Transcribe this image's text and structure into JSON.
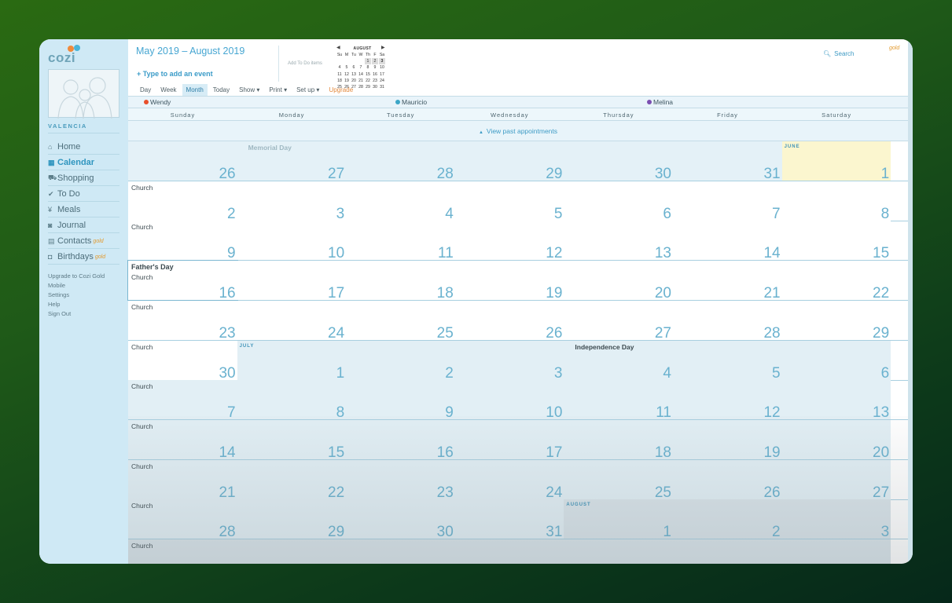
{
  "app": {
    "logo": "cozi"
  },
  "sidebar": {
    "family": "VALENCIA",
    "items": [
      {
        "icon": "home-icon",
        "glyph": "⌂",
        "label": "Home",
        "active": false,
        "gold": ""
      },
      {
        "icon": "calendar-icon",
        "glyph": "▦",
        "label": "Calendar",
        "active": true,
        "gold": ""
      },
      {
        "icon": "shopping-cart-icon",
        "glyph": "⛟",
        "label": "Shopping",
        "active": false,
        "gold": ""
      },
      {
        "icon": "checkmark-icon",
        "glyph": "✔",
        "label": "To Do",
        "active": false,
        "gold": ""
      },
      {
        "icon": "fork-knife-icon",
        "glyph": "¥",
        "label": "Meals",
        "active": false,
        "gold": ""
      },
      {
        "icon": "camera-icon",
        "glyph": "◙",
        "label": "Journal",
        "active": false,
        "gold": ""
      },
      {
        "icon": "contacts-icon",
        "glyph": "▤",
        "label": "Contacts",
        "active": false,
        "gold": "gold"
      },
      {
        "icon": "gift-icon",
        "glyph": "◘",
        "label": "Birthdays",
        "active": false,
        "gold": "gold"
      }
    ],
    "links": [
      "Upgrade to Cozi Gold",
      "Mobile",
      "Settings",
      "Help",
      "Sign Out"
    ]
  },
  "header": {
    "title": "May 2019 – August 2019",
    "add_event": "+ Type to add an event",
    "add_todo": "Add To Do items",
    "tabs": [
      {
        "label": "Day",
        "active": false,
        "kind": ""
      },
      {
        "label": "Week",
        "active": false,
        "kind": ""
      },
      {
        "label": "Month",
        "active": true,
        "kind": ""
      },
      {
        "label": "Today",
        "active": false,
        "kind": ""
      },
      {
        "label": "Show ▾",
        "active": false,
        "kind": ""
      },
      {
        "label": "Print ▾",
        "active": false,
        "kind": ""
      },
      {
        "label": "Set up ▾",
        "active": false,
        "kind": ""
      },
      {
        "label": "Upgrade",
        "active": false,
        "kind": "upgrade"
      }
    ],
    "search_placeholder": "Search",
    "gold_label": "gold"
  },
  "mini_calendar": {
    "title": "AUGUST",
    "prev": "◀",
    "next": "▶",
    "weekdays": [
      "Su",
      "M",
      "Tu",
      "W",
      "Th",
      "F",
      "Sa"
    ],
    "weeks": [
      [
        "",
        "",
        "",
        "",
        "1",
        "2",
        "3"
      ],
      [
        "4",
        "5",
        "6",
        "7",
        "8",
        "9",
        "10"
      ],
      [
        "11",
        "12",
        "13",
        "14",
        "15",
        "16",
        "17"
      ],
      [
        "18",
        "19",
        "20",
        "21",
        "22",
        "23",
        "24"
      ],
      [
        "25",
        "26",
        "27",
        "28",
        "29",
        "30",
        "31"
      ]
    ]
  },
  "members": [
    {
      "name": "Wendy",
      "color": "#e8502c"
    },
    {
      "name": "Mauricio",
      "color": "#3ba6c7"
    },
    {
      "name": "Melina",
      "color": "#7b4fb1"
    }
  ],
  "weekdays": [
    "Sunday",
    "Monday",
    "Tuesday",
    "Wednesday",
    "Thursday",
    "Friday",
    "Saturday"
  ],
  "view_past": "View past appointments",
  "calendar": {
    "colors": {
      "may": "#e4f1f7",
      "june": "#ffffff",
      "july": "#e2eff5",
      "august": "#d9e4ea",
      "june1": "#fbf6cf"
    },
    "weeks": [
      {
        "days": [
          "26",
          "27",
          "28",
          "29",
          "30",
          "31",
          "1"
        ],
        "months": [
          "may",
          "may",
          "may",
          "may",
          "may",
          "may",
          "june1"
        ],
        "events": [],
        "holidays": [
          {
            "day": 1,
            "text": "Memorial Day",
            "faded": true
          }
        ],
        "month_labels": [
          {
            "day": 6,
            "text": "JUNE"
          }
        ]
      },
      {
        "days": [
          "2",
          "3",
          "4",
          "5",
          "6",
          "7",
          "8"
        ],
        "months": [
          "june",
          "june",
          "june",
          "june",
          "june",
          "june",
          "june"
        ],
        "events": [
          {
            "day": 0,
            "text": "Church",
            "bold": false
          }
        ],
        "holidays": [],
        "month_labels": []
      },
      {
        "days": [
          "9",
          "10",
          "11",
          "12",
          "13",
          "14",
          "15"
        ],
        "months": [
          "june",
          "june",
          "june",
          "june",
          "june",
          "june",
          "june"
        ],
        "events": [
          {
            "day": 0,
            "text": "Church",
            "bold": false
          }
        ],
        "holidays": [],
        "month_labels": []
      },
      {
        "days": [
          "16",
          "17",
          "18",
          "19",
          "20",
          "21",
          "22"
        ],
        "months": [
          "june",
          "june",
          "june",
          "june",
          "june",
          "june",
          "june"
        ],
        "events": [
          {
            "day": 0,
            "text": "Father's Day",
            "bold": true
          },
          {
            "day": 0,
            "text": "Church",
            "bold": false,
            "second": true
          }
        ],
        "holidays": [],
        "month_labels": [],
        "selected": 0
      },
      {
        "days": [
          "23",
          "24",
          "25",
          "26",
          "27",
          "28",
          "29"
        ],
        "months": [
          "june",
          "june",
          "june",
          "june",
          "june",
          "june",
          "june"
        ],
        "events": [
          {
            "day": 0,
            "text": "Church",
            "bold": false
          }
        ],
        "holidays": [],
        "month_labels": []
      },
      {
        "days": [
          "30",
          "1",
          "2",
          "3",
          "4",
          "5",
          "6"
        ],
        "months": [
          "june",
          "july",
          "july",
          "july",
          "july",
          "july",
          "july"
        ],
        "events": [
          {
            "day": 0,
            "text": "Church",
            "bold": false
          }
        ],
        "holidays": [
          {
            "day": 4,
            "text": "Independence Day",
            "faded": false
          }
        ],
        "month_labels": [
          {
            "day": 1,
            "text": "JULY"
          }
        ]
      },
      {
        "days": [
          "7",
          "8",
          "9",
          "10",
          "11",
          "12",
          "13"
        ],
        "months": [
          "july",
          "july",
          "july",
          "july",
          "july",
          "july",
          "july"
        ],
        "events": [
          {
            "day": 0,
            "text": "Church",
            "bold": false
          }
        ],
        "holidays": [],
        "month_labels": []
      },
      {
        "days": [
          "14",
          "15",
          "16",
          "17",
          "18",
          "19",
          "20"
        ],
        "months": [
          "july",
          "july",
          "july",
          "july",
          "july",
          "july",
          "july"
        ],
        "events": [
          {
            "day": 0,
            "text": "Church",
            "bold": false
          }
        ],
        "holidays": [],
        "month_labels": []
      },
      {
        "days": [
          "21",
          "22",
          "23",
          "24",
          "25",
          "26",
          "27"
        ],
        "months": [
          "july",
          "july",
          "july",
          "july",
          "july",
          "july",
          "july"
        ],
        "events": [
          {
            "day": 0,
            "text": "Church",
            "bold": false
          }
        ],
        "holidays": [],
        "month_labels": []
      },
      {
        "days": [
          "28",
          "29",
          "30",
          "31",
          "1",
          "2",
          "3"
        ],
        "months": [
          "july",
          "july",
          "july",
          "july",
          "august",
          "august",
          "august"
        ],
        "events": [
          {
            "day": 0,
            "text": "Church",
            "bold": false
          }
        ],
        "holidays": [],
        "month_labels": [
          {
            "day": 4,
            "text": "AUGUST"
          }
        ]
      },
      {
        "days": [
          "",
          "",
          "",
          "",
          "",
          "",
          ""
        ],
        "months": [
          "august",
          "august",
          "august",
          "august",
          "august",
          "august",
          "august"
        ],
        "events": [
          {
            "day": 0,
            "text": "Church",
            "bold": false
          }
        ],
        "holidays": [],
        "month_labels": []
      }
    ]
  }
}
